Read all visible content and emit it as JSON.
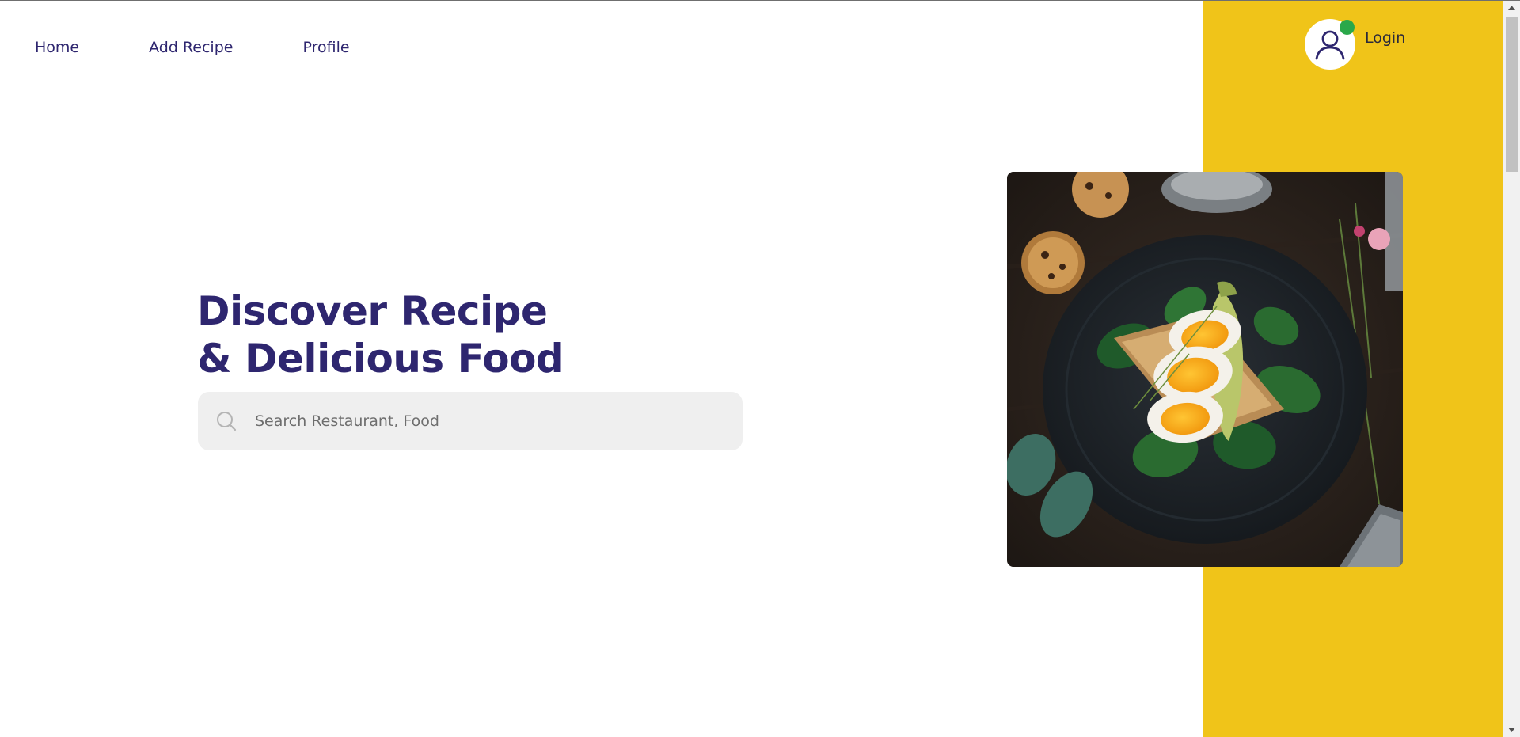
{
  "colors": {
    "accent_yellow": "#f0c419",
    "brand_purple": "#2e266f",
    "status_green": "#2aa84a",
    "search_background": "#efefef"
  },
  "nav": {
    "items": [
      {
        "label": "Home"
      },
      {
        "label": "Add Recipe"
      },
      {
        "label": "Profile"
      }
    ]
  },
  "user": {
    "login_label": "Login",
    "avatar_icon": "user-icon",
    "status": "online"
  },
  "hero": {
    "title_line1": "Discover Recipe",
    "title_line2": "& Delicious Food",
    "image_icon": "food-plate-image"
  },
  "search": {
    "placeholder": "Search Restaurant, Food",
    "value": "",
    "icon": "search-icon"
  }
}
